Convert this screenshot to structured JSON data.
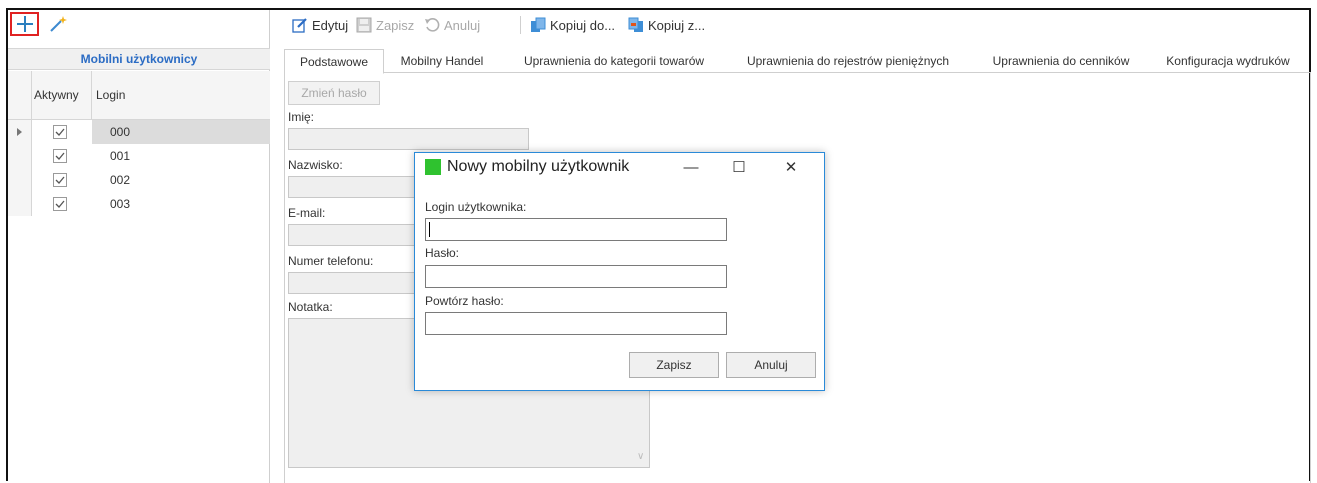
{
  "left_panel": {
    "title": "Mobilni użytkownicy",
    "columns": {
      "active": "Aktywny",
      "login": "Login"
    },
    "rows": [
      {
        "login": "000",
        "active": true,
        "selected": true
      },
      {
        "login": "001",
        "active": true,
        "selected": false
      },
      {
        "login": "002",
        "active": true,
        "selected": false
      },
      {
        "login": "003",
        "active": true,
        "selected": false
      }
    ]
  },
  "toolbar": {
    "edit": "Edytuj",
    "save": "Zapisz",
    "cancel": "Anuluj",
    "copy_to": "Kopiuj do...",
    "copy_from": "Kopiuj z..."
  },
  "tabs": [
    "Podstawowe",
    "Mobilny Handel",
    "Uprawnienia do kategorii towarów",
    "Uprawnienia do rejestrów pieniężnych",
    "Uprawnienia do cenników",
    "Konfiguracja wydruków"
  ],
  "form": {
    "change_password": "Zmień hasło",
    "first_name": "Imię:",
    "last_name": "Nazwisko:",
    "email": "E-mail:",
    "phone": "Numer telefonu:",
    "notes": "Notatka:"
  },
  "dialog": {
    "title": "Nowy mobilny użytkownik",
    "login_label": "Login użytkownika:",
    "password_label": "Hasło:",
    "repeat_password_label": "Powtórz hasło:",
    "save": "Zapisz",
    "cancel": "Anuluj",
    "minimize": "—",
    "maximize": "☐",
    "close": "✕"
  },
  "colors": {
    "accent_blue": "#2b6cc4",
    "highlight_red": "#e02222",
    "dialog_border": "#2a8ad8"
  }
}
